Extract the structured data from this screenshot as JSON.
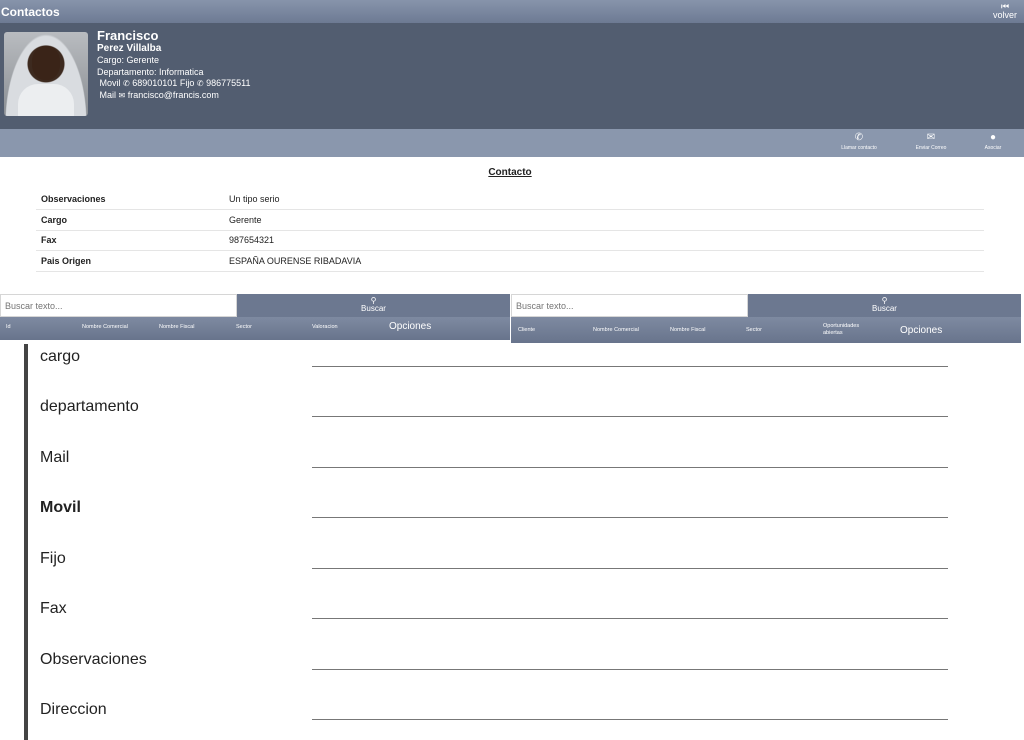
{
  "topbar": {
    "title": "Contactos",
    "back_label": "volver",
    "back_icon": "chevron-left-icon"
  },
  "profile": {
    "first_name": "Francisco",
    "last_name": "Perez Villalba",
    "cargo": "Cargo: Gerente",
    "departamento": "Departamento: Informatica",
    "movil_label": "Movil",
    "movil_value": "689010101",
    "fijo_label": "Fijo",
    "fijo_value": "986775511",
    "mail_label": "Mail",
    "mail_value": "francisco@francis.com"
  },
  "actions": [
    {
      "label": "Llamar contacto",
      "icon": "phone-icon"
    },
    {
      "label": "Enviar Correo",
      "icon": "envelope-icon"
    },
    {
      "label": "Asociar",
      "icon": "user-icon"
    }
  ],
  "contact": {
    "title": "Contacto",
    "rows": [
      {
        "key": "Observaciones",
        "value": "Un tipo serio"
      },
      {
        "key": "Cargo",
        "value": "Gerente"
      },
      {
        "key": "Fax",
        "value": "987654321"
      },
      {
        "key": "Pais Origen",
        "value": "ESPAÑA OURENSE RIBADAVIA"
      }
    ]
  },
  "left_search": {
    "placeholder": "Buscar texto...",
    "button_label": "Buscar",
    "columns": [
      "Id",
      "Nombre Comercial",
      "Nombre Fiscal",
      "Sector",
      "Valoracion",
      "Opciones"
    ]
  },
  "right_search": {
    "placeholder": "Buscar texto...",
    "button_label": "Buscar",
    "columns": [
      "Cliente",
      "Nombre Comercial",
      "Nombre Fiscal",
      "Sector",
      "Oportunidades",
      "abiertas",
      "Opciones"
    ]
  },
  "form_fields": [
    {
      "label": "cargo"
    },
    {
      "label": "departamento"
    },
    {
      "label": "Mail"
    },
    {
      "label": "Movil"
    },
    {
      "label": "Fijo"
    },
    {
      "label": "Fax"
    },
    {
      "label": "Observaciones"
    },
    {
      "label": "Direccion"
    }
  ]
}
